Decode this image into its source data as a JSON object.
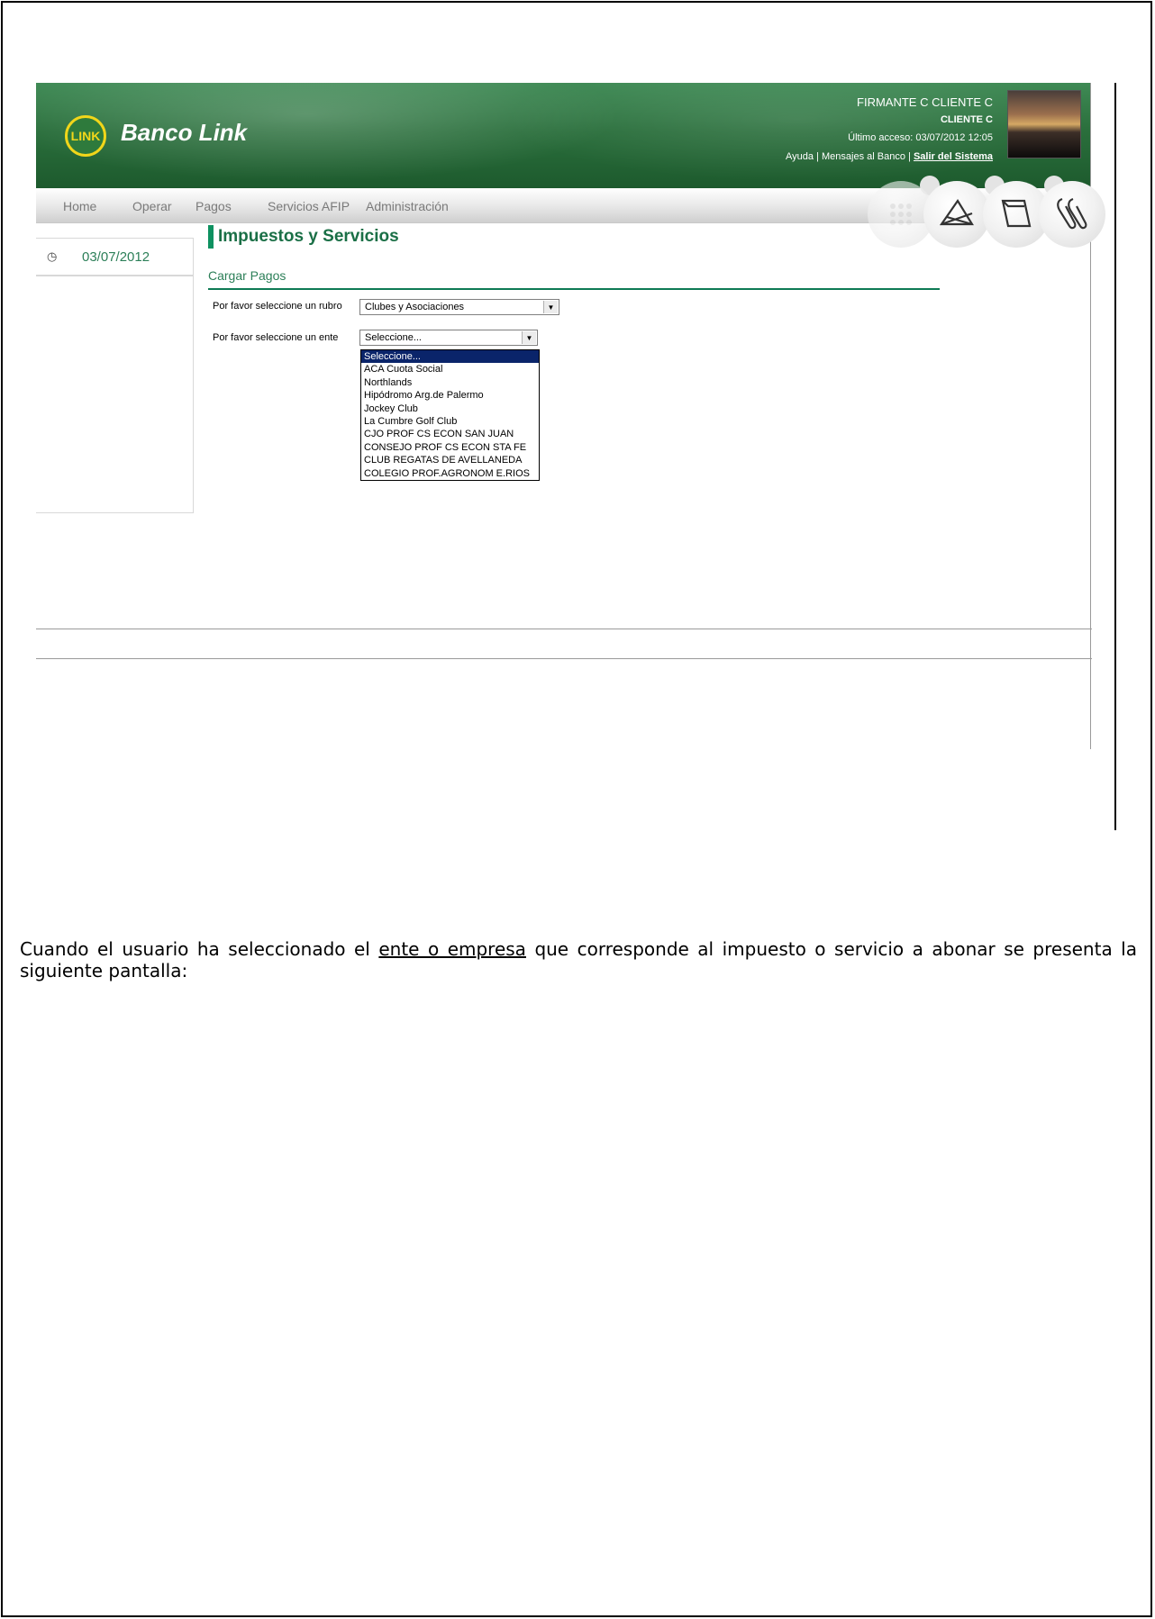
{
  "header": {
    "logo_text": "LINK",
    "brand": "Banco Link",
    "user_name": "FIRMANTE C CLIENTE C",
    "user_short": "CLIENTE C",
    "last_access": "Último acceso: 03/07/2012 12:05",
    "link_help": "Ayuda",
    "link_sep1": " | ",
    "link_messages": "Mensajes al Banco",
    "link_sep2": " | ",
    "link_logout": "Salir del Sistema"
  },
  "nav": {
    "items": [
      "Home",
      "Operar",
      "Pagos",
      "Servicios AFIP",
      "Administración"
    ]
  },
  "tools": [
    "calculator-icon",
    "envelope-icon",
    "folder-icon",
    "paperclip-icon"
  ],
  "sidebar": {
    "date": "03/07/2012"
  },
  "main": {
    "title": "Impuestos y Servicios",
    "section": "Cargar Pagos",
    "rubro_label": "Por favor seleccione un rubro",
    "rubro_value": "Clubes y Asociaciones",
    "ente_label": "Por favor seleccione un ente",
    "ente_value": "Seleccione...",
    "ente_options": [
      "Seleccione...",
      "ACA Cuota Social",
      "Northlands",
      "Hipódromo Arg.de Palermo",
      "Jockey Club",
      "La Cumbre Golf Club",
      "CJO PROF CS ECON SAN JUAN",
      "CONSEJO PROF CS ECON STA FE",
      "CLUB REGATAS DE AVELLANEDA",
      "COLEGIO PROF.AGRONOM E.RIOS"
    ]
  },
  "caption": {
    "part1": "Cuando el usuario ha seleccionado el ",
    "underlined": "ente o empresa",
    "part2": " que corresponde al impuesto o servicio a abonar se presenta la siguiente pantalla:"
  },
  "colors": {
    "header_green": "#2a6f3c",
    "accent_green": "#0e9160",
    "logo_yellow": "#f1d61a",
    "selected_option": "#0a246a"
  }
}
